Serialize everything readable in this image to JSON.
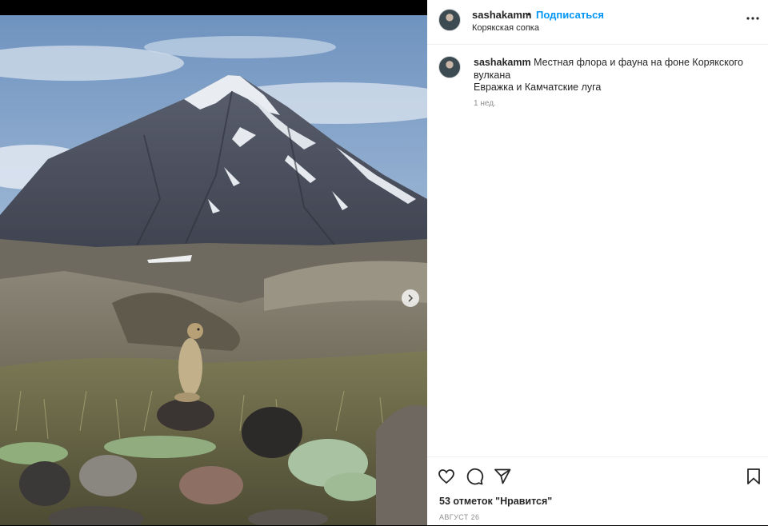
{
  "post": {
    "username": "sashakamm",
    "separator": "•",
    "follow_label": "Подписаться",
    "location": "Корякская сопка",
    "caption_line1": "Местная флора и фауна на фоне Корякского вулкана",
    "caption_line2": "Евражка и Камчатские луга",
    "time_ago": "1 нед.",
    "likes": "53 отметок \"Нравится\"",
    "date": "АВГУСТ 26"
  },
  "icons": {
    "more": "more-options-icon",
    "like": "heart-icon",
    "comment": "comment-icon",
    "share": "share-icon",
    "save": "bookmark-icon",
    "next": "chevron-right-icon"
  },
  "colors": {
    "follow": "#0095f6",
    "text": "#262626",
    "muted": "#8e8e8e"
  }
}
